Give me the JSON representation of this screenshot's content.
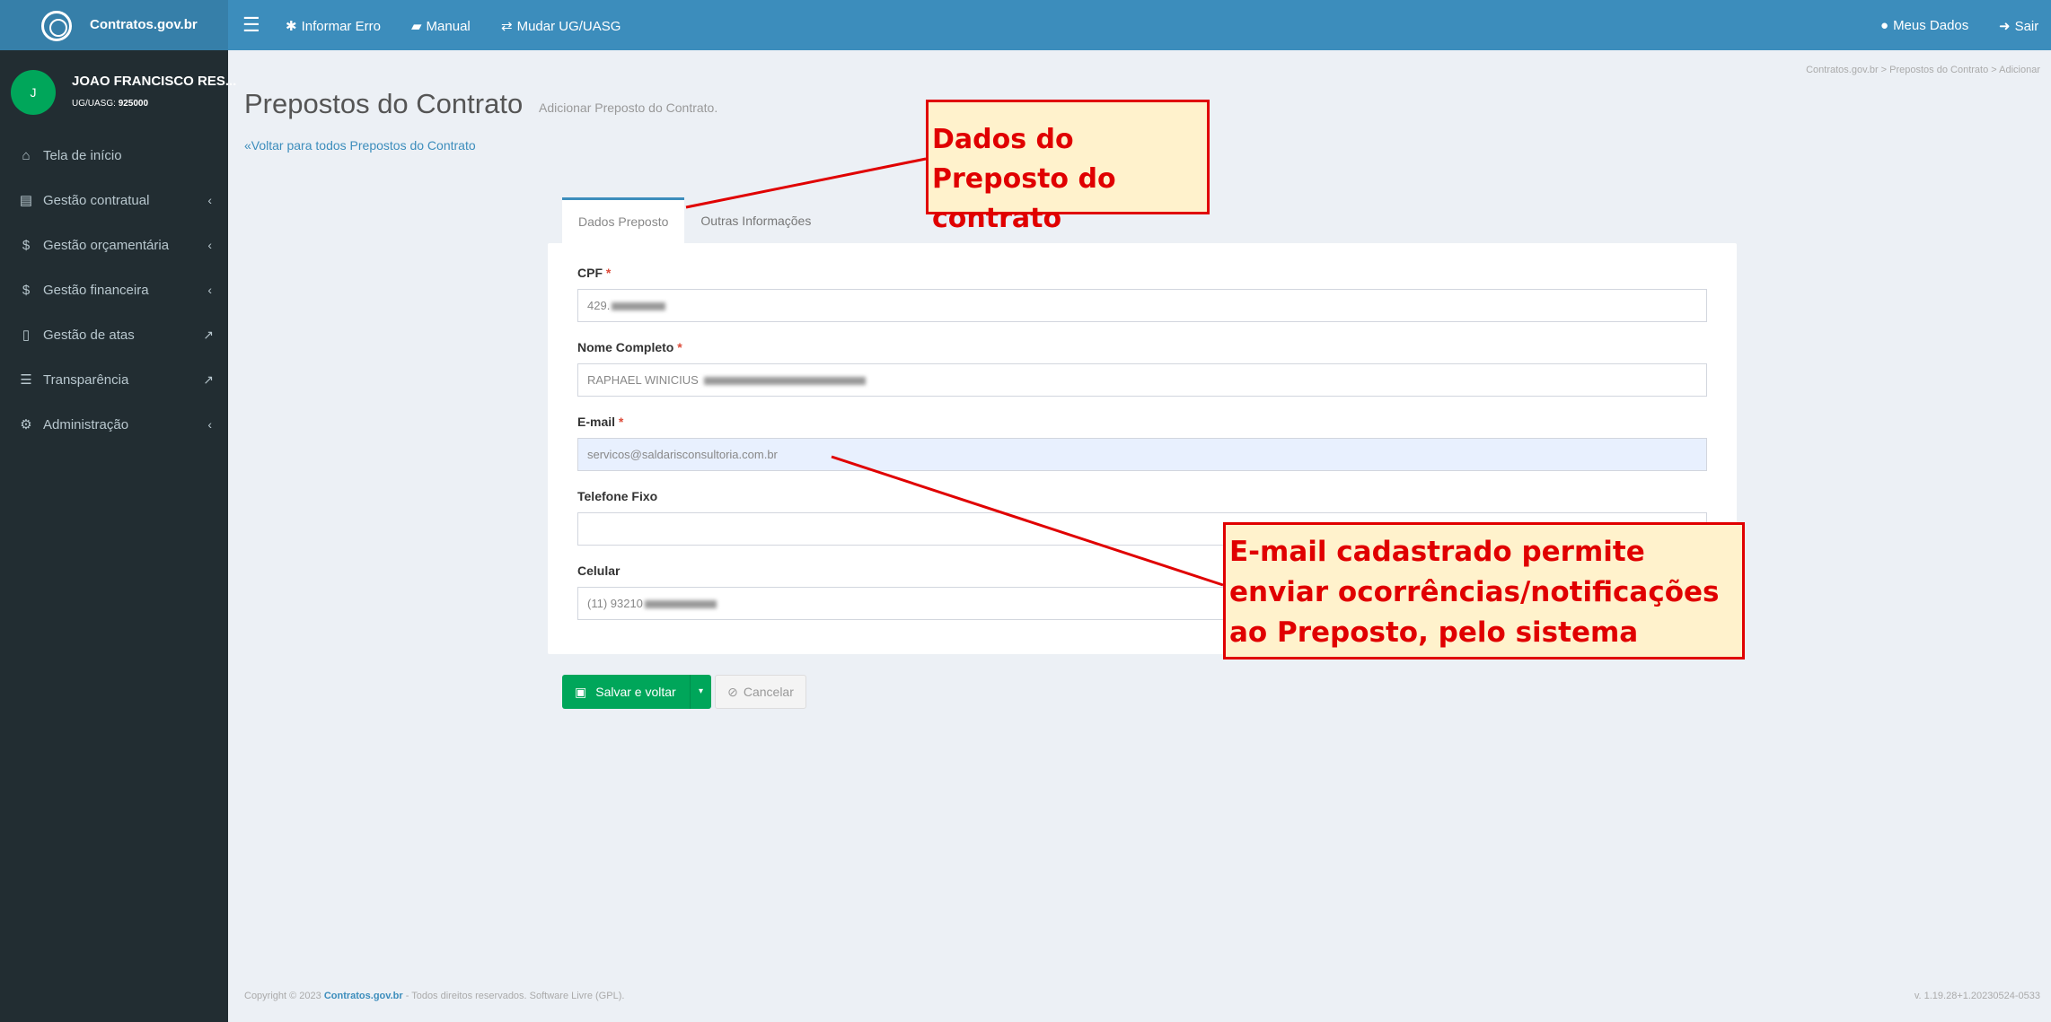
{
  "header": {
    "logo_text": "Contratos.gov.br",
    "nav": [
      {
        "icon": "bug-icon",
        "label": "Informar Erro"
      },
      {
        "icon": "book-icon",
        "label": "Manual"
      },
      {
        "icon": "exchange-icon",
        "label": "Mudar UG/UASG"
      }
    ],
    "meus_dados": "Meus Dados",
    "sair": "Sair"
  },
  "sidebar": {
    "avatar_letter": "J",
    "user_name": "JOAO FRANCISCO RES...",
    "ug_label": "UG/UASG:",
    "ug_value": "925000",
    "items": [
      {
        "label": "Tela de início",
        "icon": "home-icon"
      },
      {
        "label": "Gestão contratual",
        "icon": "file-text-icon"
      },
      {
        "label": "Gestão orçamentária",
        "icon": "dollar-icon"
      },
      {
        "label": "Gestão financeira",
        "icon": "dollar-icon"
      },
      {
        "label": "Gestão de atas",
        "icon": "file-icon"
      },
      {
        "label": "Transparência",
        "icon": "list-icon"
      },
      {
        "label": "Administração",
        "icon": "cogs-icon"
      }
    ]
  },
  "page": {
    "title": "Prepostos do Contrato",
    "subtitle": "Adicionar Preposto do Contrato.",
    "breadcrumb": "Contratos.gov.br  >  Prepostos do Contrato  >  Adicionar",
    "back_link": "Voltar para todos Prepostos do Contrato"
  },
  "tabs": [
    {
      "label": "Dados Preposto",
      "active": true
    },
    {
      "label": "Outras Informações",
      "active": false
    }
  ],
  "form": {
    "cpf_label": "CPF",
    "cpf_value": "429.",
    "nome_label": "Nome Completo",
    "nome_value": "RAPHAEL WINICIUS",
    "email_label": "E-mail",
    "email_value": "servicos@saldarisconsultoria.com.br",
    "telefone_label": "Telefone Fixo",
    "telefone_value": "",
    "celular_label": "Celular",
    "celular_value": "(11) 93210",
    "required_mark": "*"
  },
  "buttons": {
    "save": "Salvar e voltar",
    "cancel": "Cancelar"
  },
  "footer": {
    "copyright_prefix": "Copyright © 2023",
    "brand": "Contratos.gov.br",
    "copyright_suffix": "- Todos direitos reservados. Software Livre (GPL).",
    "version": "v. 1.19.28+1.20230524-0533"
  },
  "annotations": {
    "note1": "Dados do Preposto do contrato",
    "note2": "E-mail cadastrado permite enviar ocorrências/notificações ao Preposto, pelo sistema"
  },
  "colors": {
    "header": "#3c8dbc",
    "sidebar": "#222d32",
    "save_button": "#00a65a",
    "annotation_border": "#e00000",
    "annotation_fill": "#fff2cc"
  }
}
